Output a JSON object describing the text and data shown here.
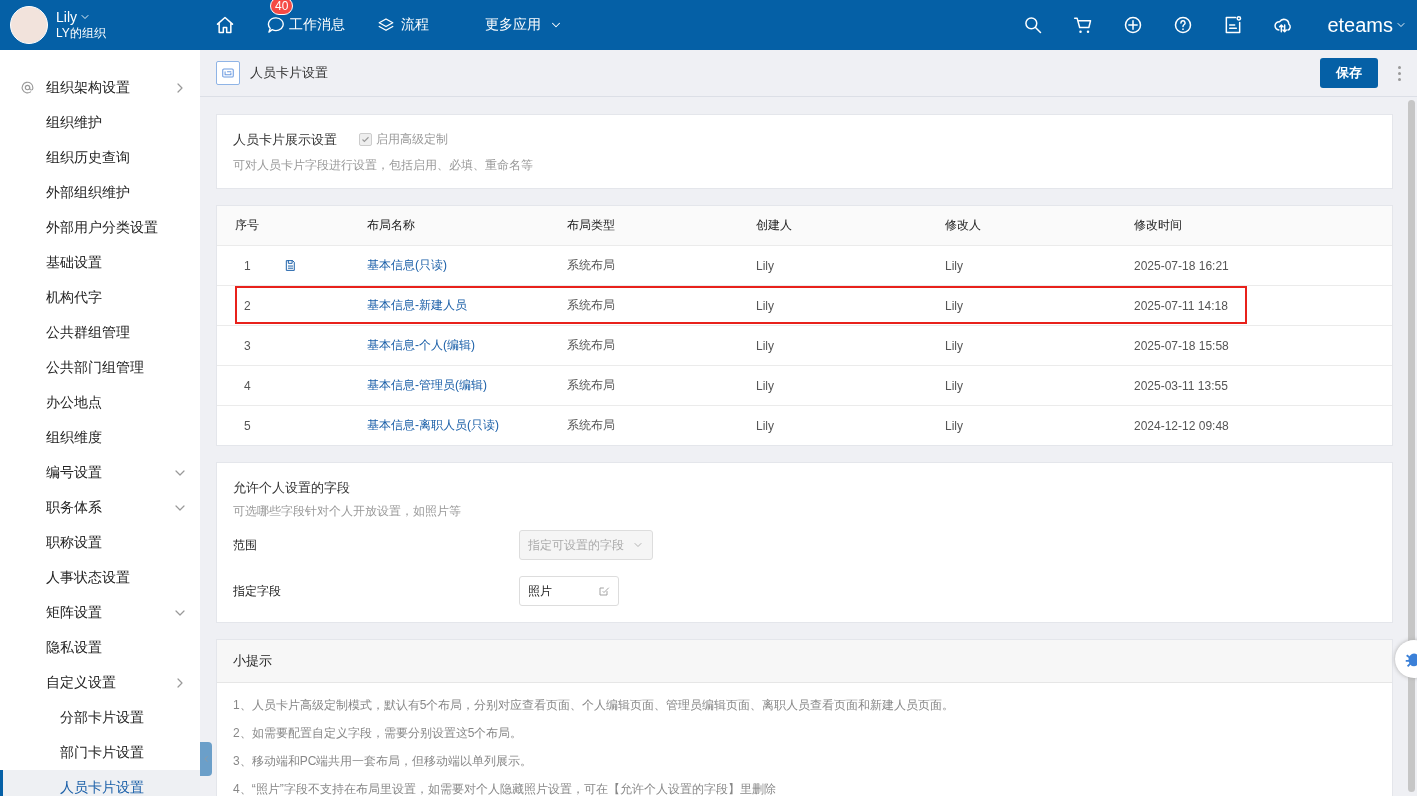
{
  "header": {
    "user": {
      "name": "Lily",
      "org": "LY的组织"
    },
    "nav": [
      {
        "kind": "home"
      },
      {
        "kind": "messages",
        "label": "工作消息",
        "badge": "40"
      },
      {
        "kind": "flow",
        "label": "流程"
      },
      {
        "kind": "more",
        "label": "更多应用"
      }
    ],
    "brand": "eteams"
  },
  "sidebar": {
    "items": [
      {
        "label": "组织架构设置",
        "expanded": true,
        "selected": false,
        "children": [
          {
            "label": "组织维护",
            "selected": false
          },
          {
            "label": "组织历史查询",
            "selected": false
          },
          {
            "label": "外部组织维护",
            "selected": false
          },
          {
            "label": "外部用户分类设置",
            "selected": false
          },
          {
            "label": "基础设置",
            "selected": false
          },
          {
            "label": "机构代字",
            "selected": false
          },
          {
            "label": "公共群组管理",
            "selected": false
          },
          {
            "label": "公共部门组管理",
            "selected": false
          },
          {
            "label": "办公地点",
            "selected": false
          },
          {
            "label": "组织维度",
            "selected": false
          },
          {
            "label": "编号设置",
            "expanded": false,
            "selected": false
          },
          {
            "label": "职务体系",
            "expanded": false,
            "selected": false
          },
          {
            "label": "职称设置",
            "selected": false
          },
          {
            "label": "人事状态设置",
            "selected": false
          },
          {
            "label": "矩阵设置",
            "expanded": false,
            "selected": false
          },
          {
            "label": "隐私设置",
            "selected": false
          },
          {
            "label": "自定义设置",
            "expanded": true,
            "selected": false,
            "children": [
              {
                "label": "分部卡片设置",
                "selected": false
              },
              {
                "label": "部门卡片设置",
                "selected": false
              },
              {
                "label": "人员卡片设置",
                "selected": true
              }
            ]
          }
        ]
      }
    ]
  },
  "page": {
    "title": "人员卡片设置",
    "save_button": "保存"
  },
  "display_settings": {
    "title": "人员卡片展示设置",
    "checkbox": {
      "label": "启用高级定制",
      "checked": true,
      "disabled": true
    },
    "description": "可对人员卡片字段进行设置，包括启用、必填、重命名等"
  },
  "table": {
    "columns": [
      "序号",
      "布局名称",
      "布局类型",
      "创建人",
      "修改人",
      "修改时间"
    ],
    "rows": [
      {
        "index": "1",
        "has_icon": true,
        "name": "基本信息(只读)",
        "type": "系统布局",
        "creator": "Lily",
        "modifier": "Lily",
        "modified": "2025-07-18 16:21",
        "highlighted": false
      },
      {
        "index": "2",
        "has_icon": false,
        "name": "基本信息-新建人员",
        "type": "系统布局",
        "creator": "Lily",
        "modifier": "Lily",
        "modified": "2025-07-11 14:18",
        "highlighted": true
      },
      {
        "index": "3",
        "has_icon": false,
        "name": "基本信息-个人(编辑)",
        "type": "系统布局",
        "creator": "Lily",
        "modifier": "Lily",
        "modified": "2025-07-18 15:58",
        "highlighted": false
      },
      {
        "index": "4",
        "has_icon": false,
        "name": "基本信息-管理员(编辑)",
        "type": "系统布局",
        "creator": "Lily",
        "modifier": "Lily",
        "modified": "2025-03-11 13:55",
        "highlighted": false
      },
      {
        "index": "5",
        "has_icon": false,
        "name": "基本信息-离职人员(只读)",
        "type": "系统布局",
        "creator": "Lily",
        "modifier": "Lily",
        "modified": "2024-12-12 09:48",
        "highlighted": false
      }
    ]
  },
  "personal_fields": {
    "title": "允许个人设置的字段",
    "description": "可选哪些字段针对个人开放设置，如照片等",
    "scope": {
      "label": "范围",
      "value": "指定可设置的字段",
      "disabled": true
    },
    "fields": {
      "label": "指定字段",
      "value": "照片"
    }
  },
  "tips": {
    "title": "小提示",
    "items": [
      "1、人员卡片高级定制模式，默认有5个布局，分别对应查看页面、个人编辑页面、管理员编辑页面、离职人员查看页面和新建人员页面。",
      "2、如需要配置自定义字段，需要分别设置这5个布局。",
      "3、移动端和PC端共用一套布局，但移动端以单列展示。",
      "4、“照片”字段不支持在布局里设置，如需要对个人隐藏照片设置，可在【允许个人设置的字段】里删除"
    ]
  }
}
